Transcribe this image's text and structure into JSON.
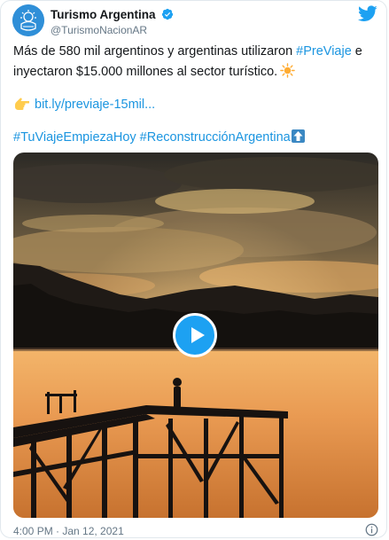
{
  "header": {
    "display_name": "Turismo Argentina",
    "handle": "@TurismoNacionAR"
  },
  "tweet": {
    "line1_pre": "Más de 580 mil argentinos y argentinas utilizaron ",
    "hashtag_previaje": "#PreViaje",
    "line1_post": " e inyectaron $15.000 millones al sector turístico.",
    "link": "bit.ly/previaje-15mil...",
    "hashtag_1": "#TuViajeEmpiezaHoy",
    "hashtag_2": "#ReconstrucciónArgentina"
  },
  "footer": {
    "timestamp": "4:00 PM · Jan 12, 2021"
  },
  "icons": {
    "verified": "verified-badge-icon",
    "twitter": "twitter-bird-icon",
    "sun": "sun-emoji",
    "hand": "pointing-hand-emoji",
    "arrow": "up-arrow-emoji",
    "play": "play-icon",
    "info": "info-icon"
  },
  "colors": {
    "accent": "#1b95e0",
    "twitter_blue": "#1da1f2",
    "text": "#14171a",
    "muted": "#657786"
  }
}
